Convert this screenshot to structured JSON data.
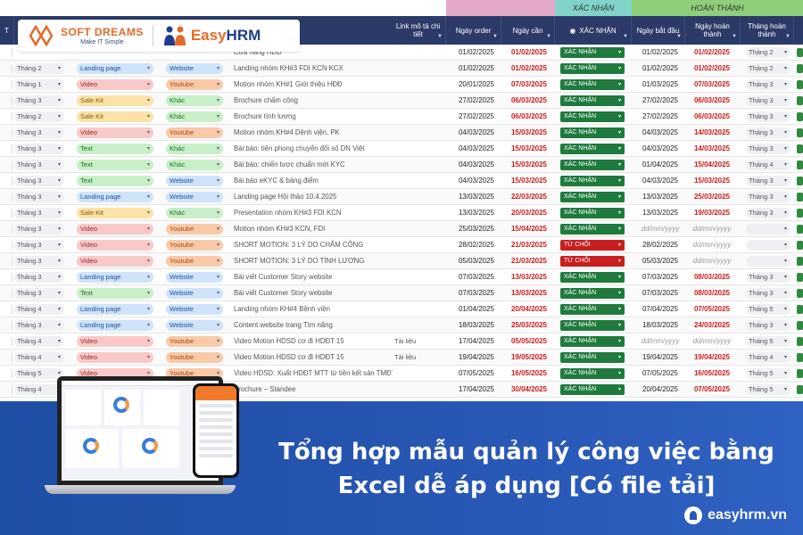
{
  "groups": {
    "confirm": "XÁC NHẬN",
    "complete": "HOÀN THÀNH"
  },
  "headers": {
    "col_a": "T",
    "link": "Link mô tả chi tiết",
    "order_date": "Ngày order",
    "due_date": "Ngày cần",
    "confirm": "XÁC NHẬN",
    "start_date": "Ngày bắt đầu",
    "done_date": "Ngày hoàn thành",
    "done_month": "Tháng hoàn thành"
  },
  "logos": {
    "softdreams_name": "SOFT DREAMS",
    "softdreams_tag": "Make IT Simple",
    "easyhrm_easy": "Easy",
    "easyhrm_hrm": "HRM"
  },
  "rows": [
    {
      "month": "",
      "type": "",
      "channel": "",
      "task": "Cửa hàng HĐĐ",
      "link": "",
      "order": "01/02/2025",
      "due": "01/02/2025",
      "status": "XÁC NHẬN",
      "status_kind": "ok",
      "start": "01/02/2025",
      "done": "01/02/2025",
      "done_month": "Tháng 2"
    },
    {
      "month": "Tháng 2",
      "type": "Landing page",
      "type_kind": "landing",
      "channel": "Website",
      "channel_kind": "web",
      "task": "Landing nhóm KH#3 FDI KCN KCX",
      "link": "",
      "order": "01/02/2025",
      "due": "01/02/2025",
      "status": "XÁC NHẬN",
      "status_kind": "ok",
      "start": "01/02/2025",
      "done": "01/02/2025",
      "done_month": "Tháng 2"
    },
    {
      "month": "Tháng 1",
      "type": "Video",
      "type_kind": "video",
      "channel": "Youtube",
      "channel_kind": "yt",
      "task": "Motion nhóm KH#1 Giới thiệu HĐĐ",
      "link": "",
      "order": "20/01/2025",
      "due": "07/03/2025",
      "status": "XÁC NHẬN",
      "status_kind": "ok",
      "start": "01/03/2025",
      "done": "07/03/2025",
      "done_month": "Tháng 3"
    },
    {
      "month": "Tháng 3",
      "type": "Sale Kit",
      "type_kind": "sale",
      "channel": "Khác",
      "channel_kind": "other",
      "task": "Brochure chấm công",
      "link": "",
      "order": "27/02/2025",
      "due": "06/03/2025",
      "status": "XÁC NHẬN",
      "status_kind": "ok",
      "start": "27/02/2025",
      "done": "06/03/2025",
      "done_month": "Tháng 3"
    },
    {
      "month": "Tháng 2",
      "type": "Sale Kit",
      "type_kind": "sale",
      "channel": "Khác",
      "channel_kind": "other",
      "task": "Brochure tính lương",
      "link": "",
      "order": "27/02/2025",
      "due": "06/03/2025",
      "status": "XÁC NHẬN",
      "status_kind": "ok",
      "start": "27/02/2025",
      "done": "06/03/2025",
      "done_month": "Tháng 3"
    },
    {
      "month": "Tháng 3",
      "type": "Video",
      "type_kind": "video",
      "channel": "Youtube",
      "channel_kind": "yt",
      "task": "Motion nhóm KH#4 Dệnh viện, PK",
      "link": "",
      "order": "04/03/2025",
      "due": "15/03/2025",
      "status": "XÁC NHẬN",
      "status_kind": "ok",
      "start": "04/03/2025",
      "done": "14/03/2025",
      "done_month": "Tháng 3"
    },
    {
      "month": "Tháng 3",
      "type": "Text",
      "type_kind": "text",
      "channel": "Khác",
      "channel_kind": "other",
      "task": "Bài báo: tiên phong chuyển đổi số DN Việt",
      "link": "",
      "order": "04/03/2025",
      "due": "15/03/2025",
      "status": "XÁC NHẬN",
      "status_kind": "ok",
      "start": "04/03/2025",
      "done": "14/03/2025",
      "done_month": "Tháng 3"
    },
    {
      "month": "Tháng 3",
      "type": "Text",
      "type_kind": "text",
      "channel": "Khác",
      "channel_kind": "other",
      "task": "Bài báo: chiến lược chuẩn mới KYC",
      "link": "",
      "order": "04/03/2025",
      "due": "15/03/2025",
      "status": "XÁC NHẬN",
      "status_kind": "ok",
      "start": "01/04/2025",
      "done": "15/04/2025",
      "done_month": "Tháng 4"
    },
    {
      "month": "Tháng 3",
      "type": "Text",
      "type_kind": "text",
      "channel": "Website",
      "channel_kind": "web",
      "task": "Bài báo eKYC & bảng điểm",
      "link": "",
      "order": "04/03/2025",
      "due": "15/03/2025",
      "status": "XÁC NHẬN",
      "status_kind": "ok",
      "start": "04/03/2025",
      "done": "15/03/2025",
      "done_month": "Tháng 3"
    },
    {
      "month": "Tháng 3",
      "type": "Landing page",
      "type_kind": "landing",
      "channel": "Website",
      "channel_kind": "web",
      "task": "Landing page Hội thảo 10.4.2025",
      "link": "",
      "order": "13/03/2025",
      "due": "22/03/2025",
      "status": "XÁC NHẬN",
      "status_kind": "ok",
      "start": "13/03/2025",
      "done": "25/03/2025",
      "done_month": "Tháng 3"
    },
    {
      "month": "Tháng 3",
      "type": "Sale Kit",
      "type_kind": "sale",
      "channel": "Khác",
      "channel_kind": "other",
      "task": "Presentation nhóm KH#3 FDI KCN",
      "link": "",
      "order": "13/03/2025",
      "due": "20/03/2025",
      "status": "XÁC NHẬN",
      "status_kind": "ok",
      "start": "13/03/2025",
      "done": "19/03/2025",
      "done_month": "Tháng 3"
    },
    {
      "month": "Tháng 3",
      "type": "Video",
      "type_kind": "video",
      "channel": "Youtube",
      "channel_kind": "yt",
      "task": "Motion nhóm KH#3 KCN, FDI",
      "link": "",
      "order": "25/03/2025",
      "due": "15/04/2025",
      "status": "XÁC NHẬN",
      "status_kind": "ok",
      "start": "dd/mm/yyyy",
      "done": "dd/mm/yyyy",
      "done_month": ""
    },
    {
      "month": "Tháng 3",
      "type": "Video",
      "type_kind": "video",
      "channel": "Youtube",
      "channel_kind": "yt",
      "task": "SHORT MOTION: 3 LÝ DO CHẤM CÔNG",
      "link": "",
      "order": "28/02/2025",
      "due": "21/03/2025",
      "status": "TỪ CHỐI",
      "status_kind": "no",
      "start": "28/02/2025",
      "done": "dd/mm/yyyy",
      "done_month": ""
    },
    {
      "month": "Tháng 3",
      "type": "Video",
      "type_kind": "video",
      "channel": "Youtube",
      "channel_kind": "yt",
      "task": "SHORT MOTION: 3 LÝ DO TÍNH LƯƠNG",
      "link": "",
      "order": "05/03/2025",
      "due": "21/03/2025",
      "status": "TỪ CHỐI",
      "status_kind": "no",
      "start": "05/03/2025",
      "done": "dd/mm/yyyy",
      "done_month": ""
    },
    {
      "month": "Tháng 3",
      "type": "Landing page",
      "type_kind": "landing",
      "channel": "Website",
      "channel_kind": "web",
      "task": "Bài viết Customer Story website",
      "link": "",
      "order": "07/03/2025",
      "due": "13/03/2025",
      "status": "XÁC NHẬN",
      "status_kind": "ok",
      "start": "07/03/2025",
      "done": "08/03/2025",
      "done_month": "Tháng 3"
    },
    {
      "month": "Tháng 3",
      "type": "Text",
      "type_kind": "text",
      "channel": "Website",
      "channel_kind": "web",
      "task": "Bài viết Customer Story website",
      "link": "",
      "order": "07/03/2025",
      "due": "13/03/2025",
      "status": "XÁC NHẬN",
      "status_kind": "ok",
      "start": "07/03/2025",
      "done": "08/03/2025",
      "done_month": "Tháng 3"
    },
    {
      "month": "Tháng 4",
      "type": "Landing page",
      "type_kind": "landing",
      "channel": "Website",
      "channel_kind": "web",
      "task": "Landing nhóm KH#4 Bệnh viện",
      "link": "",
      "order": "01/04/2025",
      "due": "20/04/2025",
      "status": "XÁC NHẬN",
      "status_kind": "ok",
      "start": "07/04/2025",
      "done": "07/05/2025",
      "done_month": "Tháng 5"
    },
    {
      "month": "Tháng 3",
      "type": "Landing page",
      "type_kind": "landing",
      "channel": "Website",
      "channel_kind": "web",
      "task": "Content website trang Tìm năng",
      "link": "",
      "order": "18/03/2025",
      "due": "25/03/2025",
      "status": "XÁC NHẬN",
      "status_kind": "ok",
      "start": "18/03/2025",
      "done": "24/03/2025",
      "done_month": "Tháng 3"
    },
    {
      "month": "Tháng 4",
      "type": "Video",
      "type_kind": "video",
      "channel": "Youtube",
      "channel_kind": "yt",
      "task": "Video Motion HDSD cơ đi HDĐT 15",
      "link": "Tài liệu",
      "order": "17/04/2025",
      "due": "05/05/2025",
      "status": "XÁC NHẬN",
      "status_kind": "ok",
      "start": "dd/mm/yyyy",
      "done": "dd/mm/yyyy",
      "done_month": "Tháng 5"
    },
    {
      "month": "Tháng 4",
      "type": "Video",
      "type_kind": "video",
      "channel": "Youtube",
      "channel_kind": "yt",
      "task": "Video Motion HDSD cơ đi HDĐT 15",
      "link": "Tài liệu",
      "order": "19/04/2025",
      "due": "19/05/2025",
      "status": "XÁC NHẬN",
      "status_kind": "ok",
      "start": "19/04/2025",
      "done": "19/04/2025",
      "done_month": "Tháng 4"
    },
    {
      "month": "Tháng 5",
      "type": "Video",
      "type_kind": "video",
      "channel": "Youtube",
      "channel_kind": "yt",
      "task": "Video HDSD: Xuất HDĐT MTT từ tiền kết sản TMĐT",
      "link": "",
      "order": "07/05/2025",
      "due": "16/05/2025",
      "status": "XÁC NHẬN",
      "status_kind": "ok",
      "start": "07/05/2025",
      "done": "16/05/2025",
      "done_month": "Tháng 5"
    },
    {
      "month": "Tháng 4",
      "type": "",
      "channel": "",
      "task": "Brochure – Standee",
      "link": "",
      "order": "17/04/2025",
      "due": "30/04/2025",
      "status": "XÁC NHẬN",
      "status_kind": "ok",
      "start": "20/04/2025",
      "done": "07/05/2025",
      "done_month": "Tháng 5"
    }
  ],
  "banner": {
    "title_line1": "Tổng hợp mẫu quản lý công việc bằng",
    "title_line2": "Excel dễ áp dụng [Có file tải]",
    "site": "easyhrm.vn"
  }
}
